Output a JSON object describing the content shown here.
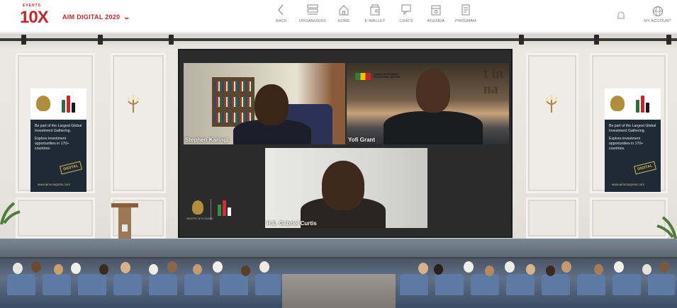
{
  "brand": {
    "logo_top": "EVENTS",
    "logo_main": "10X",
    "event_name": "AIM DIGITAL 2020"
  },
  "nav": [
    {
      "label": "BACK",
      "icon": "back-chevron-icon"
    },
    {
      "label": "ORGANIZERS",
      "icon": "organizers-icon"
    },
    {
      "label": "HOME",
      "icon": "home-icon"
    },
    {
      "label": "E-WALLET",
      "icon": "wallet-icon"
    },
    {
      "label": "CHATS",
      "icon": "chat-icon"
    },
    {
      "label": "AGENDA",
      "icon": "agenda-icon"
    },
    {
      "label": "PROGRAM",
      "icon": "program-icon"
    }
  ],
  "account": {
    "label": "MY ACCOUNT",
    "notification_icon": "bell-icon",
    "account_icon": "globe-account-icon"
  },
  "video": {
    "participants": [
      {
        "name": "Stephen Karingi"
      },
      {
        "name": "Yofi Grant"
      },
      {
        "name": "H.E. Gabriel Curtis"
      }
    ],
    "tile2_background_text": "t in\nna",
    "tile2_logo_text": "GHANA INVESTMENT PROMOTION CENTRE"
  },
  "banners": {
    "heading": "Be part of the Largest Global Investment Gathering.",
    "body": "Explore investment opportunities in 170+ countries.",
    "stamp": "DIGITAL",
    "url": "www.aimcongress.com"
  },
  "ministry": {
    "caption": "MINISTRY OF ECONOMY"
  },
  "colors": {
    "brand_red": "#c9242b",
    "nav_gray": "#707070",
    "screen_bg": "#2b2b2b",
    "banner_bg": "#1e2a35"
  }
}
